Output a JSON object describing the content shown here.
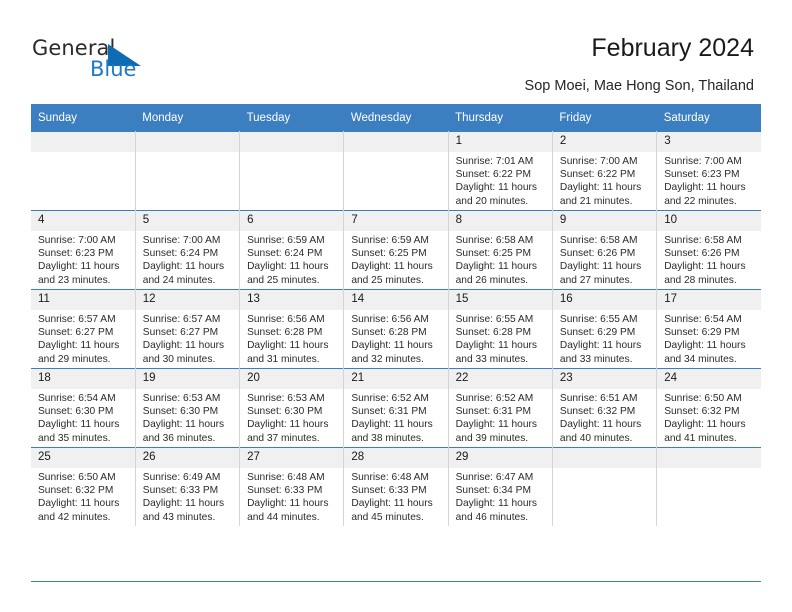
{
  "brand": {
    "name_part1": "General",
    "name_part2": "Blue",
    "accent_color": "#0d6cb4",
    "logo_icon": "triangle-logo-icon"
  },
  "header": {
    "title": "February 2024",
    "subtitle": "Sop Moei, Mae Hong Son, Thailand"
  },
  "calendar": {
    "header_color": "#3c7fc1",
    "weekday_headers": [
      "Sunday",
      "Monday",
      "Tuesday",
      "Wednesday",
      "Thursday",
      "Friday",
      "Saturday"
    ],
    "weeks": [
      [
        {
          "day": "",
          "empty": true
        },
        {
          "day": "",
          "empty": true
        },
        {
          "day": "",
          "empty": true
        },
        {
          "day": "",
          "empty": true
        },
        {
          "day": "1",
          "sunrise": "Sunrise: 7:01 AM",
          "sunset": "Sunset: 6:22 PM",
          "daylight": "Daylight: 11 hours and 20 minutes."
        },
        {
          "day": "2",
          "sunrise": "Sunrise: 7:00 AM",
          "sunset": "Sunset: 6:22 PM",
          "daylight": "Daylight: 11 hours and 21 minutes."
        },
        {
          "day": "3",
          "sunrise": "Sunrise: 7:00 AM",
          "sunset": "Sunset: 6:23 PM",
          "daylight": "Daylight: 11 hours and 22 minutes."
        }
      ],
      [
        {
          "day": "4",
          "sunrise": "Sunrise: 7:00 AM",
          "sunset": "Sunset: 6:23 PM",
          "daylight": "Daylight: 11 hours and 23 minutes."
        },
        {
          "day": "5",
          "sunrise": "Sunrise: 7:00 AM",
          "sunset": "Sunset: 6:24 PM",
          "daylight": "Daylight: 11 hours and 24 minutes."
        },
        {
          "day": "6",
          "sunrise": "Sunrise: 6:59 AM",
          "sunset": "Sunset: 6:24 PM",
          "daylight": "Daylight: 11 hours and 25 minutes."
        },
        {
          "day": "7",
          "sunrise": "Sunrise: 6:59 AM",
          "sunset": "Sunset: 6:25 PM",
          "daylight": "Daylight: 11 hours and 25 minutes."
        },
        {
          "day": "8",
          "sunrise": "Sunrise: 6:58 AM",
          "sunset": "Sunset: 6:25 PM",
          "daylight": "Daylight: 11 hours and 26 minutes."
        },
        {
          "day": "9",
          "sunrise": "Sunrise: 6:58 AM",
          "sunset": "Sunset: 6:26 PM",
          "daylight": "Daylight: 11 hours and 27 minutes."
        },
        {
          "day": "10",
          "sunrise": "Sunrise: 6:58 AM",
          "sunset": "Sunset: 6:26 PM",
          "daylight": "Daylight: 11 hours and 28 minutes."
        }
      ],
      [
        {
          "day": "11",
          "sunrise": "Sunrise: 6:57 AM",
          "sunset": "Sunset: 6:27 PM",
          "daylight": "Daylight: 11 hours and 29 minutes."
        },
        {
          "day": "12",
          "sunrise": "Sunrise: 6:57 AM",
          "sunset": "Sunset: 6:27 PM",
          "daylight": "Daylight: 11 hours and 30 minutes."
        },
        {
          "day": "13",
          "sunrise": "Sunrise: 6:56 AM",
          "sunset": "Sunset: 6:28 PM",
          "daylight": "Daylight: 11 hours and 31 minutes."
        },
        {
          "day": "14",
          "sunrise": "Sunrise: 6:56 AM",
          "sunset": "Sunset: 6:28 PM",
          "daylight": "Daylight: 11 hours and 32 minutes."
        },
        {
          "day": "15",
          "sunrise": "Sunrise: 6:55 AM",
          "sunset": "Sunset: 6:28 PM",
          "daylight": "Daylight: 11 hours and 33 minutes."
        },
        {
          "day": "16",
          "sunrise": "Sunrise: 6:55 AM",
          "sunset": "Sunset: 6:29 PM",
          "daylight": "Daylight: 11 hours and 33 minutes."
        },
        {
          "day": "17",
          "sunrise": "Sunrise: 6:54 AM",
          "sunset": "Sunset: 6:29 PM",
          "daylight": "Daylight: 11 hours and 34 minutes."
        }
      ],
      [
        {
          "day": "18",
          "sunrise": "Sunrise: 6:54 AM",
          "sunset": "Sunset: 6:30 PM",
          "daylight": "Daylight: 11 hours and 35 minutes."
        },
        {
          "day": "19",
          "sunrise": "Sunrise: 6:53 AM",
          "sunset": "Sunset: 6:30 PM",
          "daylight": "Daylight: 11 hours and 36 minutes."
        },
        {
          "day": "20",
          "sunrise": "Sunrise: 6:53 AM",
          "sunset": "Sunset: 6:30 PM",
          "daylight": "Daylight: 11 hours and 37 minutes."
        },
        {
          "day": "21",
          "sunrise": "Sunrise: 6:52 AM",
          "sunset": "Sunset: 6:31 PM",
          "daylight": "Daylight: 11 hours and 38 minutes."
        },
        {
          "day": "22",
          "sunrise": "Sunrise: 6:52 AM",
          "sunset": "Sunset: 6:31 PM",
          "daylight": "Daylight: 11 hours and 39 minutes."
        },
        {
          "day": "23",
          "sunrise": "Sunrise: 6:51 AM",
          "sunset": "Sunset: 6:32 PM",
          "daylight": "Daylight: 11 hours and 40 minutes."
        },
        {
          "day": "24",
          "sunrise": "Sunrise: 6:50 AM",
          "sunset": "Sunset: 6:32 PM",
          "daylight": "Daylight: 11 hours and 41 minutes."
        }
      ],
      [
        {
          "day": "25",
          "sunrise": "Sunrise: 6:50 AM",
          "sunset": "Sunset: 6:32 PM",
          "daylight": "Daylight: 11 hours and 42 minutes."
        },
        {
          "day": "26",
          "sunrise": "Sunrise: 6:49 AM",
          "sunset": "Sunset: 6:33 PM",
          "daylight": "Daylight: 11 hours and 43 minutes."
        },
        {
          "day": "27",
          "sunrise": "Sunrise: 6:48 AM",
          "sunset": "Sunset: 6:33 PM",
          "daylight": "Daylight: 11 hours and 44 minutes."
        },
        {
          "day": "28",
          "sunrise": "Sunrise: 6:48 AM",
          "sunset": "Sunset: 6:33 PM",
          "daylight": "Daylight: 11 hours and 45 minutes."
        },
        {
          "day": "29",
          "sunrise": "Sunrise: 6:47 AM",
          "sunset": "Sunset: 6:34 PM",
          "daylight": "Daylight: 11 hours and 46 minutes."
        },
        {
          "day": "",
          "empty": true
        },
        {
          "day": "",
          "empty": true
        }
      ]
    ]
  }
}
